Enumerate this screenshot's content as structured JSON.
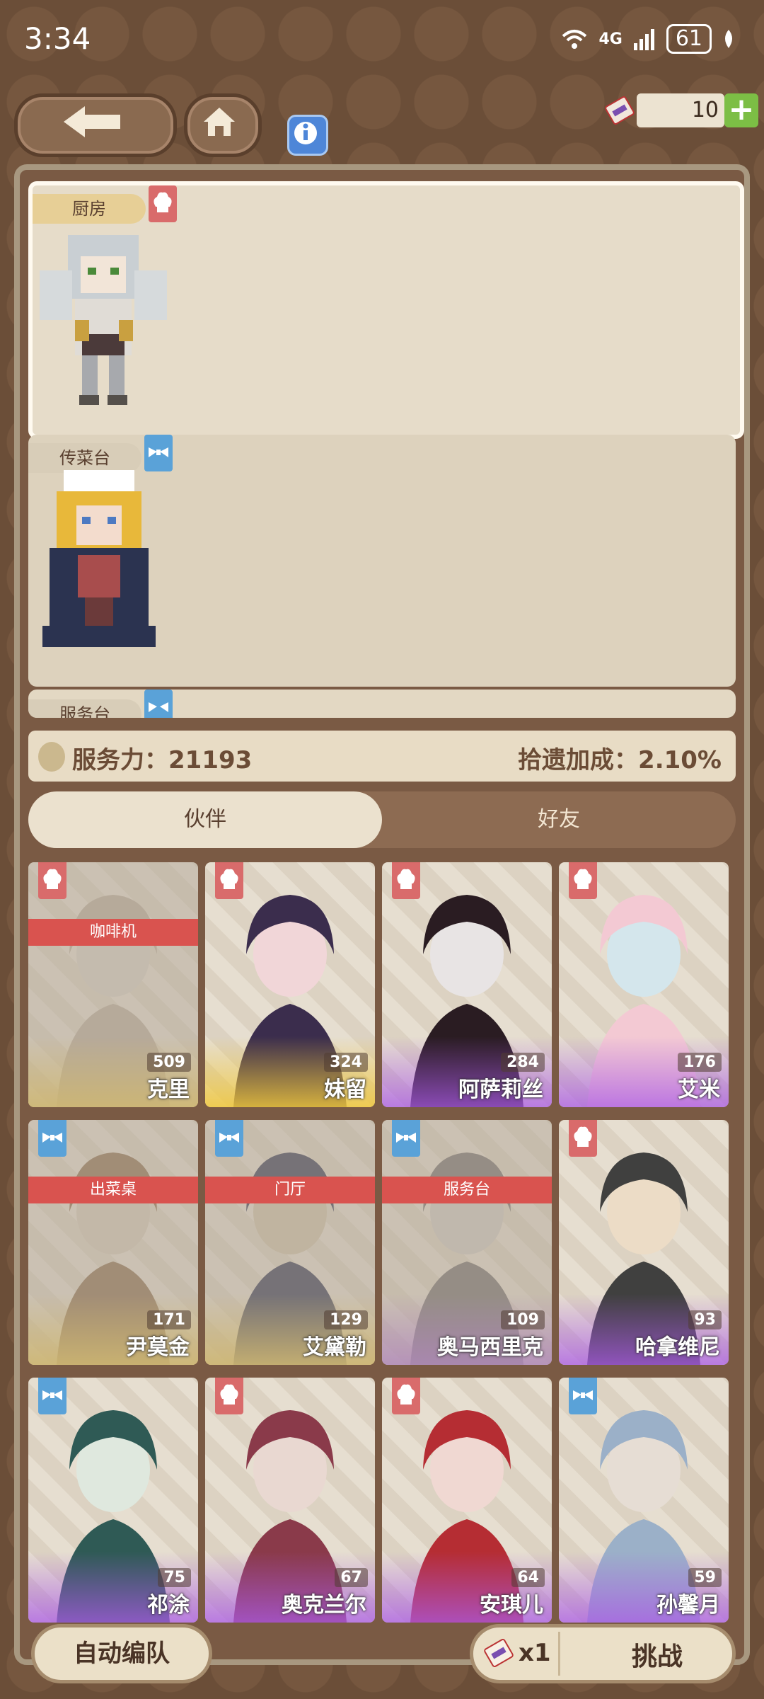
{
  "status_bar": {
    "time": "3:34",
    "network": "4G",
    "battery": "61"
  },
  "top": {
    "ticket_count": "10",
    "add_label": "+"
  },
  "sections": [
    {
      "label": "厨房",
      "role": "kitchen"
    },
    {
      "label": "传菜台",
      "role": "serve"
    },
    {
      "label": "服务台",
      "role": "serve"
    }
  ],
  "stats": {
    "service_power_label": "服务力：",
    "service_power_value": "21193",
    "bonus_label": "拾遗加成：",
    "bonus_value": "2.10%"
  },
  "tabs": {
    "partner": "伙伴",
    "friends": "好友"
  },
  "cards": [
    {
      "name": "克里",
      "power": "509",
      "role": "kitchen",
      "assigned": "咖啡机",
      "rarity": "gold"
    },
    {
      "name": "妹留",
      "power": "324",
      "role": "kitchen",
      "assigned": "",
      "rarity": "gold"
    },
    {
      "name": "阿萨莉丝",
      "power": "284",
      "role": "kitchen",
      "assigned": "",
      "rarity": "purple"
    },
    {
      "name": "艾米",
      "power": "176",
      "role": "kitchen",
      "assigned": "",
      "rarity": "purple"
    },
    {
      "name": "尹莫金",
      "power": "171",
      "role": "serve",
      "assigned": "出菜桌",
      "rarity": "gold"
    },
    {
      "name": "艾黛勒",
      "power": "129",
      "role": "serve",
      "assigned": "门厅",
      "rarity": "gold"
    },
    {
      "name": "奥马西里克",
      "power": "109",
      "role": "serve",
      "assigned": "服务台",
      "rarity": "purple"
    },
    {
      "name": "哈拿维尼",
      "power": "93",
      "role": "kitchen",
      "assigned": "",
      "rarity": "purple"
    },
    {
      "name": "祁涂",
      "power": "75",
      "role": "serve",
      "assigned": "",
      "rarity": "purple"
    },
    {
      "name": "奥克兰尔",
      "power": "67",
      "role": "kitchen",
      "assigned": "",
      "rarity": "purple"
    },
    {
      "name": "安琪儿",
      "power": "64",
      "role": "kitchen",
      "assigned": "",
      "rarity": "purple"
    },
    {
      "name": "孙馨月",
      "power": "59",
      "role": "serve",
      "assigned": "",
      "rarity": "purple"
    }
  ],
  "bottom": {
    "auto_label": "自动编队",
    "challenge_multiplier": "x1",
    "challenge_label": "挑战"
  },
  "colors": {
    "kitchen": "#d96b6b",
    "serve": "#5aa2d8",
    "accent_green": "#7cbe45",
    "info_blue": "#4e86d8"
  },
  "icons": {
    "back": "arrow-left-icon",
    "home": "house-icon",
    "info": "info-icon",
    "ticket": "ticket-icon",
    "kitchen": "chef-hat-icon",
    "serve": "bowtie-icon"
  }
}
